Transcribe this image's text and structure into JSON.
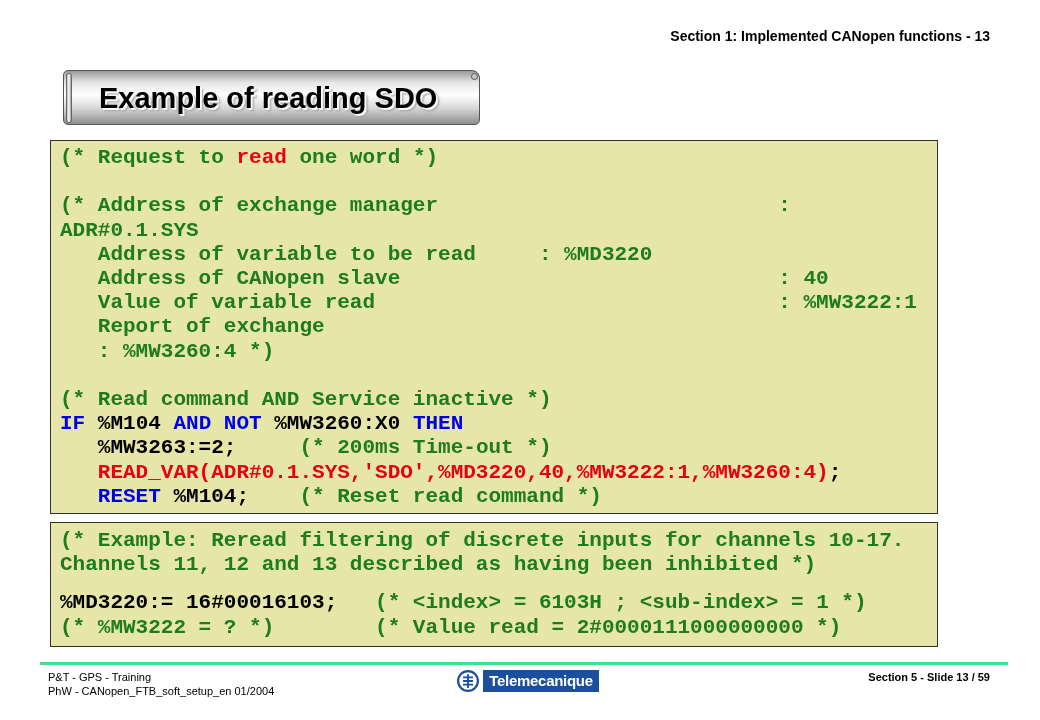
{
  "header": {
    "title": "Section 1: Implemented CANopen functions - 13"
  },
  "title": "Example of reading SDO",
  "code_blocks": [
    {
      "paragraphs": [
        [
          {
            "segments": [
              {
                "text": "(* Request to ",
                "kind": "comment"
              },
              {
                "text": "read",
                "kind": "highlight"
              },
              {
                "text": " one word *)",
                "kind": "comment"
              }
            ]
          }
        ],
        [
          {
            "segments": [
              {
                "text": "(* Address of exchange manager                           :",
                "kind": "comment"
              }
            ]
          },
          {
            "segments": [
              {
                "text": "ADR#0.1.SYS",
                "kind": "comment"
              }
            ]
          },
          {
            "segments": [
              {
                "text": "   Address of variable to be read     : %MD3220",
                "kind": "comment"
              }
            ]
          },
          {
            "segments": [
              {
                "text": "   Address of CANopen slave                              : 40",
                "kind": "comment"
              }
            ]
          },
          {
            "segments": [
              {
                "text": "   Value of variable read                                : %MW3222:1",
                "kind": "comment"
              }
            ]
          },
          {
            "segments": [
              {
                "text": "   Report of exchange",
                "kind": "comment"
              }
            ]
          },
          {
            "segments": [
              {
                "text": "   : %MW3260:4 *)",
                "kind": "comment"
              }
            ]
          }
        ],
        [
          {
            "segments": [
              {
                "text": "(* Read command AND Service inactive *)",
                "kind": "comment"
              }
            ]
          },
          {
            "segments": [
              {
                "text": "IF",
                "kind": "keyword"
              },
              {
                "text": " %M104 ",
                "kind": "code"
              },
              {
                "text": "AND NOT",
                "kind": "keyword"
              },
              {
                "text": " %MW3260:X0 ",
                "kind": "code"
              },
              {
                "text": "THEN",
                "kind": "keyword"
              }
            ]
          },
          {
            "segments": [
              {
                "text": "   %MW3263:=2;",
                "kind": "code"
              },
              {
                "text": "     (* 200ms Time-out *)",
                "kind": "comment"
              }
            ]
          },
          {
            "segments": [
              {
                "text": "   READ_VAR(ADR#0.1.SYS,'SDO',%MD3220,40,%MW3222:1,%MW3260:4)",
                "kind": "highlight"
              },
              {
                "text": ";",
                "kind": "code"
              }
            ]
          },
          {
            "segments": [
              {
                "text": "   RESET",
                "kind": "keyword"
              },
              {
                "text": " %M104;",
                "kind": "code"
              },
              {
                "text": "    (* Reset read command *)",
                "kind": "comment"
              }
            ]
          }
        ]
      ]
    },
    {
      "paragraphs": [
        [
          {
            "segments": [
              {
                "text": "(* Example: Reread filtering of discrete inputs for channels 10-17.",
                "kind": "comment"
              }
            ]
          },
          {
            "segments": [
              {
                "text": "Channels 11, 12 and 13 described as having been inhibited *)",
                "kind": "comment"
              }
            ]
          }
        ],
        [
          {
            "segments": [
              {
                "text": "%MD3220:= 16#00016103;",
                "kind": "code"
              },
              {
                "text": "   (* <index> = 6103H ; <sub-index> = 1 *)",
                "kind": "comment"
              }
            ]
          },
          {
            "segments": [
              {
                "text": "(* %MW3222 = ? *)        (* Value read = 2#0000111000000000 *)",
                "kind": "comment"
              }
            ]
          }
        ]
      ]
    }
  ],
  "footer": {
    "left_lines": [
      "P&T - GPS - Training",
      "PhW - CANopen_FTB_soft_setup_en 01/2004"
    ],
    "logo": {
      "wordmark": "Telemecanique"
    },
    "slide_number": "Section 5 - Slide 13 / 59"
  }
}
